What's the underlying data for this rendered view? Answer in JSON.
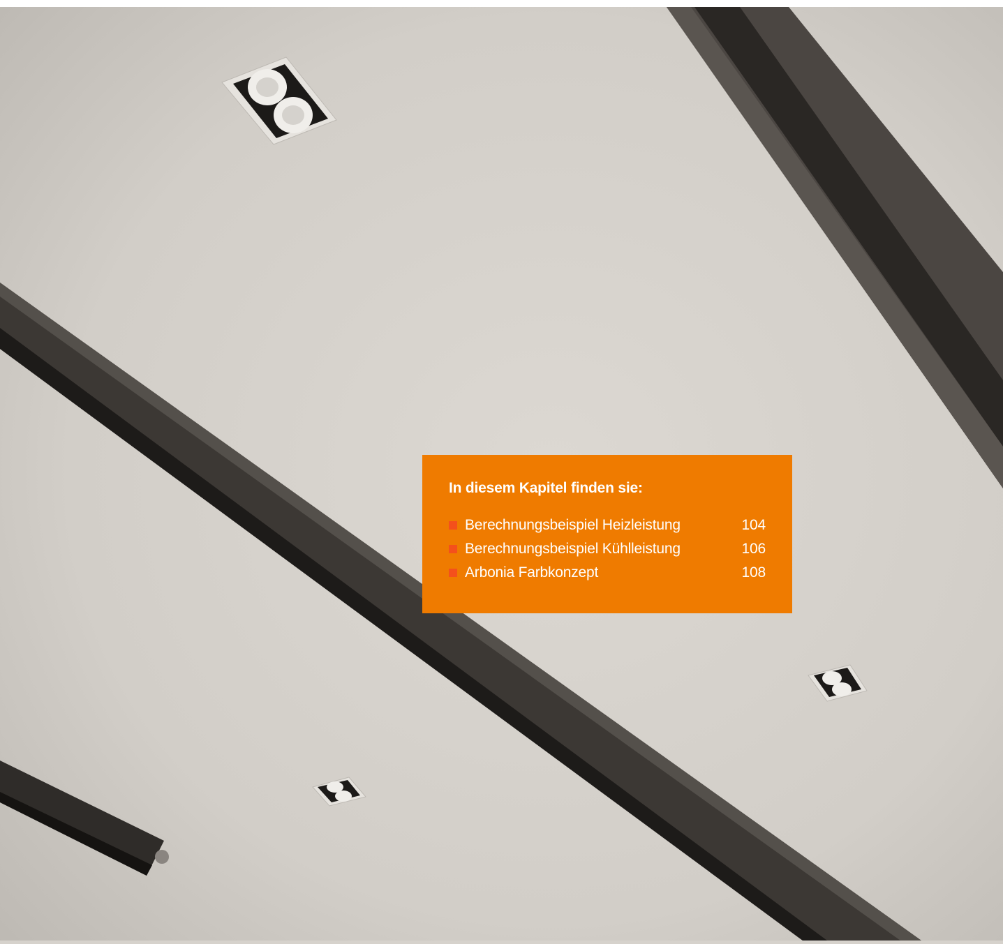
{
  "toc": {
    "title": "In diesem Kapitel finden sie:",
    "accent_color": "#ef7b00",
    "bullet_color": "#f4501c",
    "items": [
      {
        "label": "Berechnungsbeispiel Heizleistung",
        "page": "104"
      },
      {
        "label": "Berechnungsbeispiel Kühlleistung",
        "page": "106"
      },
      {
        "label": "Arbonia Farbkonzept",
        "page": "108"
      }
    ]
  }
}
